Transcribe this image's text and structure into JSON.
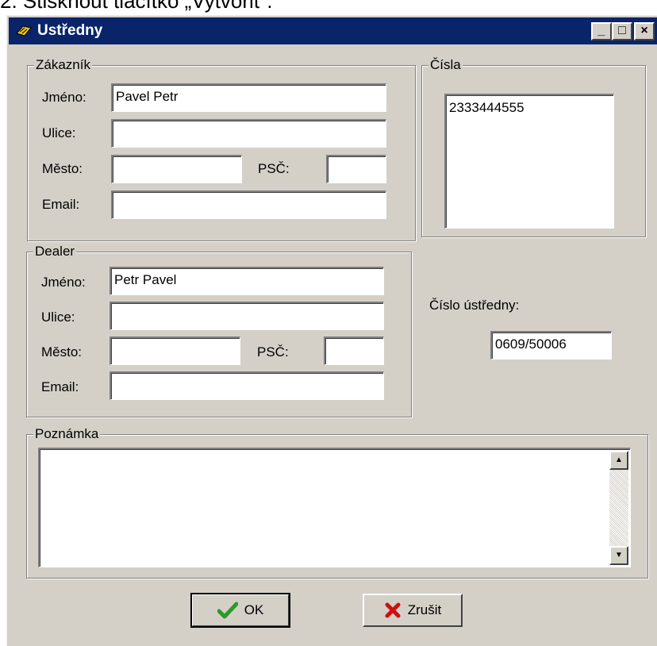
{
  "caption": "2. Stisknout tlačítko „Vytvořit\".",
  "window": {
    "title": "Ustředny",
    "controls": {
      "minimize": "_",
      "maximize": "□",
      "close": "×"
    }
  },
  "zakaznik": {
    "legend": "Zákazník",
    "jmeno_label": "Jméno:",
    "jmeno_value": "Pavel Petr",
    "ulice_label": "Ulice:",
    "ulice_value": "",
    "mesto_label": "Město:",
    "mesto_value": "",
    "psc_label": "PSČ:",
    "psc_value": "",
    "email_label": "Email:",
    "email_value": ""
  },
  "cisla": {
    "legend": "Čísla",
    "items": [
      "2333444555"
    ]
  },
  "dealer": {
    "legend": "Dealer",
    "jmeno_label": "Jméno:",
    "jmeno_value": "Petr Pavel",
    "ulice_label": "Ulice:",
    "ulice_value": "",
    "mesto_label": "Město:",
    "mesto_value": "",
    "psc_label": "PSČ:",
    "psc_value": "",
    "email_label": "Email:",
    "email_value": ""
  },
  "ustredna": {
    "label": "Číslo ústředny:",
    "value": "0609/50006"
  },
  "poznamka": {
    "legend": "Poznámka",
    "value": ""
  },
  "buttons": {
    "ok_label": "OK",
    "cancel_label": "Zrušit"
  },
  "icons": {
    "ok": "green-check-icon",
    "cancel": "red-x-icon",
    "app": "app-icon"
  },
  "colors": {
    "titlebar": "#0a246a",
    "face": "#d4d0c8",
    "ok_check": "#2a9a2a",
    "cancel_x": "#cc1010"
  }
}
